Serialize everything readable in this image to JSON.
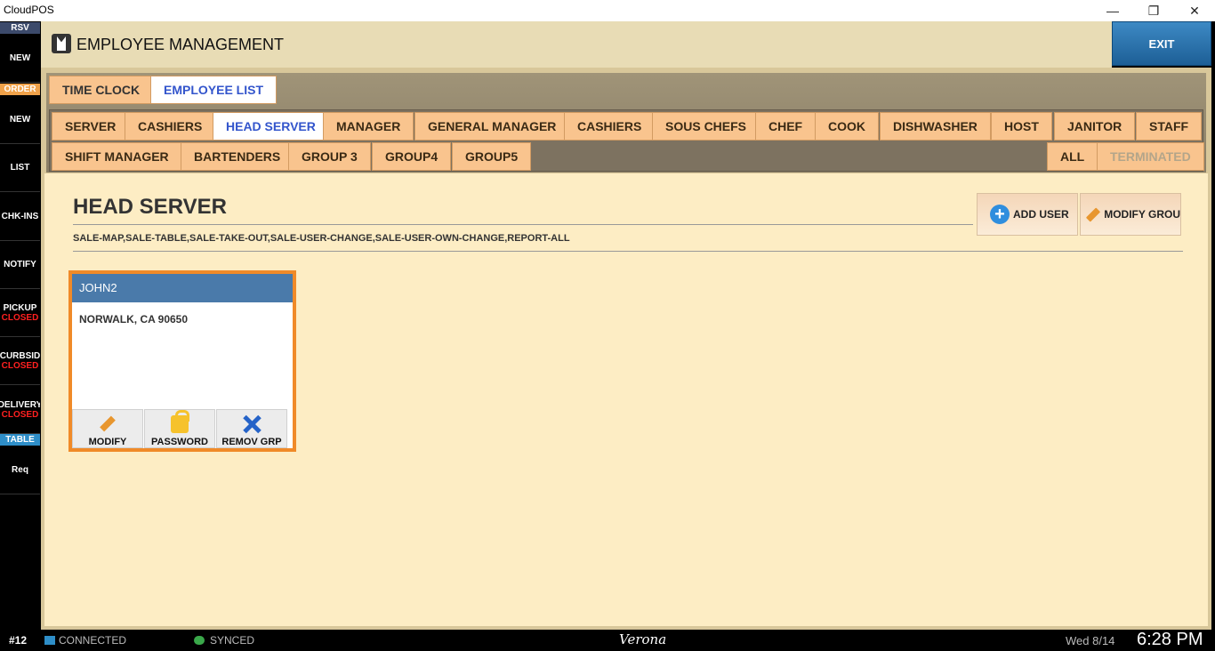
{
  "window": {
    "title": "CloudPOS",
    "minimize": "—",
    "restore": "❐",
    "close": "✕"
  },
  "sidebar": {
    "rsv_header": "RSV",
    "order_header": "ORDER",
    "table_header": "TABLE",
    "items": [
      {
        "label": "NEW"
      },
      {
        "label": "NEW"
      },
      {
        "label": "LIST"
      },
      {
        "label": "CHK-INS"
      },
      {
        "label": "NOTIFY"
      },
      {
        "label": "PICKUP",
        "status": "CLOSED"
      },
      {
        "label": "CURBSID",
        "status": "CLOSED"
      },
      {
        "label": "DELIVERY",
        "status": "CLOSED"
      },
      {
        "label": "Req"
      }
    ],
    "colors": {
      "rsv": "#3c4a6b",
      "order": "#f0a24a",
      "table": "#2e8ec8",
      "closed": "#ff2020"
    }
  },
  "header": {
    "title": "EMPLOYEE MANAGEMENT",
    "exit_label": "EXIT"
  },
  "tabs": [
    {
      "label": "TIME CLOCK"
    },
    {
      "label": "EMPLOYEE LIST"
    }
  ],
  "groups_row1": [
    "SERVER",
    "CASHIERS",
    "HEAD SERVER",
    "MANAGER",
    "GENERAL MANAGER",
    "CASHIERS",
    "SOUS CHEFS",
    "CHEF",
    "COOK",
    "DISHWASHER",
    "HOST",
    "JANITOR",
    "STAFF"
  ],
  "groups_row2": [
    "SHIFT MANAGER",
    "BARTENDERS",
    "GROUP 3",
    "GROUP4",
    "GROUP5"
  ],
  "filters": {
    "all": "ALL",
    "terminated": "TERMINATED"
  },
  "group_detail": {
    "title": "HEAD SERVER",
    "permissions": "SALE-MAP,SALE-TABLE,SALE-TAKE-OUT,SALE-USER-CHANGE,SALE-USER-OWN-CHANGE,REPORT-ALL",
    "add_user_label": "ADD USER",
    "modify_group_label": "MODIFY GROU"
  },
  "employee": {
    "name": "JOHN2",
    "address": "NORWALK, CA 90650",
    "modify_label": "MODIFY",
    "password_label": "PASSWORD",
    "remove_label": "REMOV GRP"
  },
  "status": {
    "station": "#12",
    "connected": "CONNECTED",
    "synced": "SYNCED",
    "location": "Verona",
    "date": "Wed 8/14",
    "time": "6:28 PM"
  }
}
